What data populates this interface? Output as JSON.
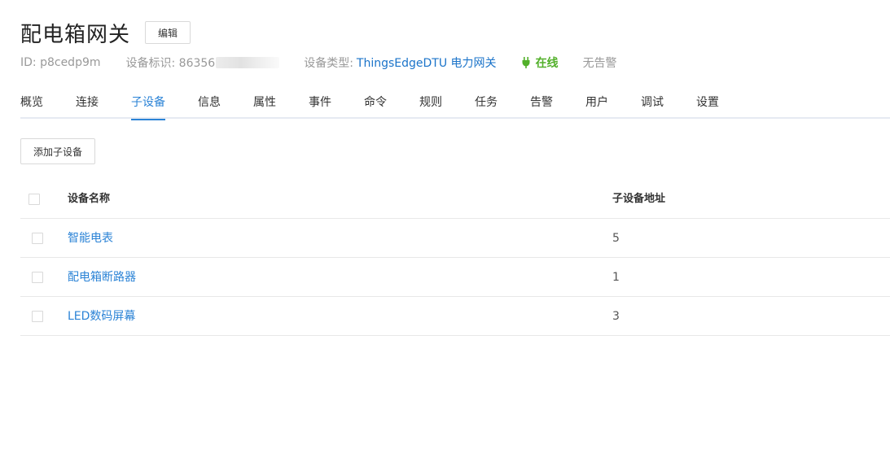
{
  "page": {
    "title": "配电箱网关",
    "edit_label": "编辑"
  },
  "meta": {
    "id_text": "ID: p8cedp9m",
    "sn_label": "设备标识: 86356",
    "type_label": "设备类型:",
    "type_value": "ThingsEdgeDTU 电力网关",
    "status": "在线",
    "status_color": "#52b02a",
    "alarm": "无告警"
  },
  "tabs": [
    {
      "label": "概览",
      "active": false
    },
    {
      "label": "连接",
      "active": false
    },
    {
      "label": "子设备",
      "active": true
    },
    {
      "label": "信息",
      "active": false
    },
    {
      "label": "属性",
      "active": false
    },
    {
      "label": "事件",
      "active": false
    },
    {
      "label": "命令",
      "active": false
    },
    {
      "label": "规则",
      "active": false
    },
    {
      "label": "任务",
      "active": false
    },
    {
      "label": "告警",
      "active": false
    },
    {
      "label": "用户",
      "active": false
    },
    {
      "label": "调试",
      "active": false
    },
    {
      "label": "设置",
      "active": false
    }
  ],
  "toolbar": {
    "add_label": "添加子设备"
  },
  "table": {
    "columns": [
      "设备名称",
      "子设备地址"
    ],
    "rows": [
      {
        "name": "智能电表",
        "address": "5"
      },
      {
        "name": "配电箱断路器",
        "address": "1"
      },
      {
        "name": "LED数码屏幕",
        "address": "3"
      }
    ]
  },
  "colors": {
    "accent": "#2b83d6",
    "online": "#52b02a"
  }
}
